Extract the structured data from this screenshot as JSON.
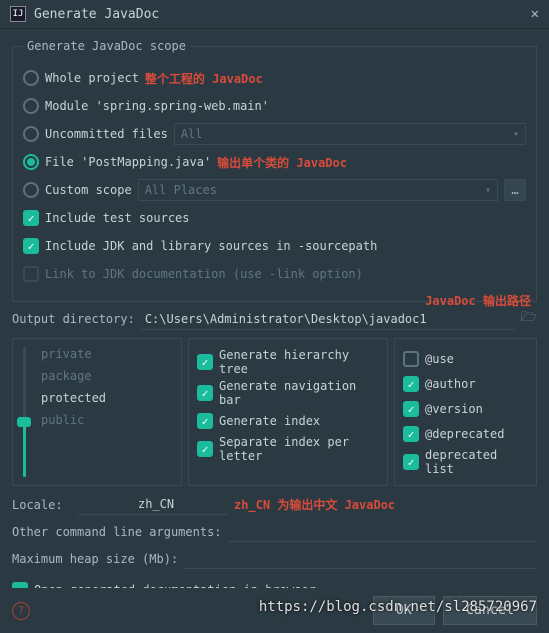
{
  "title": "Generate JavaDoc",
  "scope": {
    "legend": "Generate JavaDoc scope",
    "whole_project": "Whole project",
    "whole_project_ann": "整个工程的 JavaDoc",
    "module": "Module 'spring.spring-web.main'",
    "uncommitted": "Uncommitted files",
    "uncommitted_dd": "All",
    "file": "File 'PostMapping.java'",
    "file_ann": "输出单个类的 JavaDoc",
    "custom": "Custom scope",
    "custom_dd": "All Places",
    "include_test": "Include test sources",
    "include_jdk": "Include JDK and library sources in -sourcepath",
    "link_jdk": "Link to JDK documentation (use -link option)"
  },
  "output": {
    "ann": "JavaDoc 输出路径",
    "label": "Output directory:",
    "value": "C:\\Users\\Administrator\\Desktop\\javadoc1"
  },
  "visibility": {
    "items": [
      "private",
      "package",
      "protected",
      "public"
    ]
  },
  "generate": {
    "hierarchy": "Generate hierarchy tree",
    "navbar": "Generate navigation bar",
    "index": "Generate index",
    "sep_index": "Separate index per letter"
  },
  "tags": {
    "use": "@use",
    "author": "@author",
    "version": "@version",
    "deprecated": "@deprecated",
    "dep_list": "deprecated list"
  },
  "locale": {
    "label": "Locale:",
    "value": "zh_CN",
    "ann": "zh_CN 为输出中文 JavaDoc"
  },
  "other_args": {
    "label": "Other command line arguments:",
    "value": ""
  },
  "heap": {
    "label": "Maximum heap size (Mb):",
    "value": ""
  },
  "open_browser": "Open generated documentation in browser",
  "buttons": {
    "ok": "OK",
    "cancel": "Cancel"
  },
  "watermark": "https://blog.csdn.net/sl285720967"
}
